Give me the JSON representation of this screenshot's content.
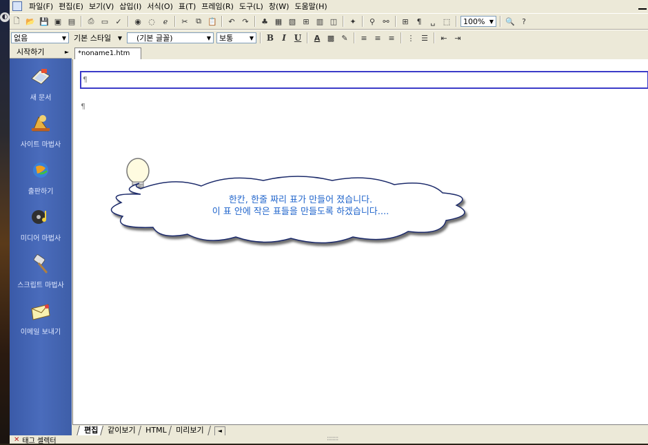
{
  "menubar": {
    "items": [
      "파일(F)",
      "편집(E)",
      "보기(V)",
      "삽입(I)",
      "서식(O)",
      "표(T)",
      "프레임(R)",
      "도구(L)",
      "창(W)",
      "도움말(H)"
    ]
  },
  "toolbar": {
    "zoom": "100%"
  },
  "format_bar": {
    "paragraph_style": "없음",
    "css_style": "기본 스타일",
    "font": "(기본 글꼴)",
    "size": "보통",
    "bold": "B",
    "italic": "I",
    "underline": "U"
  },
  "sidebar": {
    "header": "시작하기",
    "items": [
      {
        "label": "새 문서",
        "icon": "new-document-icon"
      },
      {
        "label": "사이트 마법사",
        "icon": "site-wizard-icon"
      },
      {
        "label": "출판하기",
        "icon": "publish-icon"
      },
      {
        "label": "미디어 마법사",
        "icon": "media-wizard-icon"
      },
      {
        "label": "스크립트 마법사",
        "icon": "script-wizard-icon"
      },
      {
        "label": "이메일 보내기",
        "icon": "email-send-icon"
      }
    ]
  },
  "document": {
    "tab_label": "*noname1.htm",
    "para_mark": "¶"
  },
  "callout": {
    "line1": "한칸, 한줄 짜리 표가 만들어 졌습니다.",
    "line2": "이 표 안에 작은 표들을 만들도록 하겠습니다...."
  },
  "view_tabs": [
    "편집",
    "같이보기",
    "HTML",
    "미리보기"
  ],
  "statusbar": {
    "text": "태그 셀렉터"
  }
}
